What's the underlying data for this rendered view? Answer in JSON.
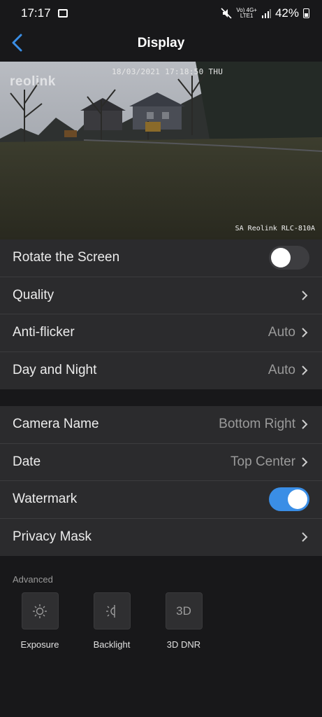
{
  "status_bar": {
    "time": "17:17",
    "network_top": "Vo) 4G+",
    "network_bottom": "LTE1",
    "battery": "42%"
  },
  "header": {
    "title": "Display",
    "back_icon": "chevron-left-icon"
  },
  "preview": {
    "timestamp": "18/03/2021 17:18:50 THU",
    "camera_label": "SA Reolink RLC-810A",
    "logo": "reolink"
  },
  "group1": {
    "rotate": {
      "label": "Rotate the Screen",
      "enabled": false
    },
    "quality": {
      "label": "Quality"
    },
    "anti_flicker": {
      "label": "Anti-flicker",
      "value": "Auto"
    },
    "day_night": {
      "label": "Day and Night",
      "value": "Auto"
    }
  },
  "group2": {
    "camera_name": {
      "label": "Camera Name",
      "value": "Bottom Right"
    },
    "date": {
      "label": "Date",
      "value": "Top Center"
    },
    "watermark": {
      "label": "Watermark",
      "enabled": true
    },
    "privacy_mask": {
      "label": "Privacy Mask"
    }
  },
  "advanced": {
    "heading": "Advanced",
    "tools": [
      {
        "label": "Exposure",
        "icon": "sun-icon"
      },
      {
        "label": "Backlight",
        "icon": "backlight-icon"
      },
      {
        "label": "3D DNR",
        "icon_text": "3D"
      }
    ]
  },
  "colors": {
    "background": "#18181a",
    "row_background": "#2b2b2d",
    "accent": "#3a8ee6"
  }
}
